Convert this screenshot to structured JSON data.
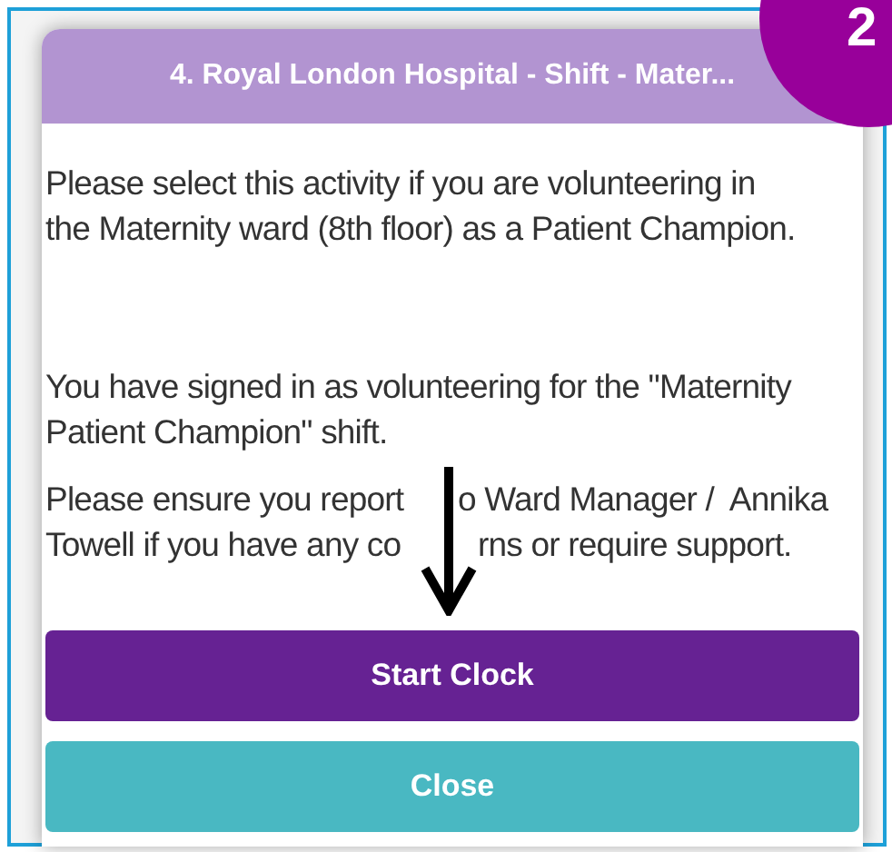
{
  "badge": "2",
  "dialog": {
    "title": "4. Royal London Hospital - Shift - Mater...",
    "paragraphs": [
      "Please select this activity if you are volunteering in the Maternity ward (8th floor) as a Patient Champion.",
      "You have signed in as volunteering for the \"Maternity Patient Champion\" shift."
    ],
    "covered_paragraph": [
      [
        "Please ensure you report",
        "o Ward Manager /  Annika"
      ],
      [
        "Towell if you have any co",
        "rns or require support."
      ]
    ],
    "buttons": [
      {
        "label": "Start Clock",
        "kind": "primary"
      },
      {
        "label": "Close",
        "kind": "secondary"
      }
    ]
  }
}
